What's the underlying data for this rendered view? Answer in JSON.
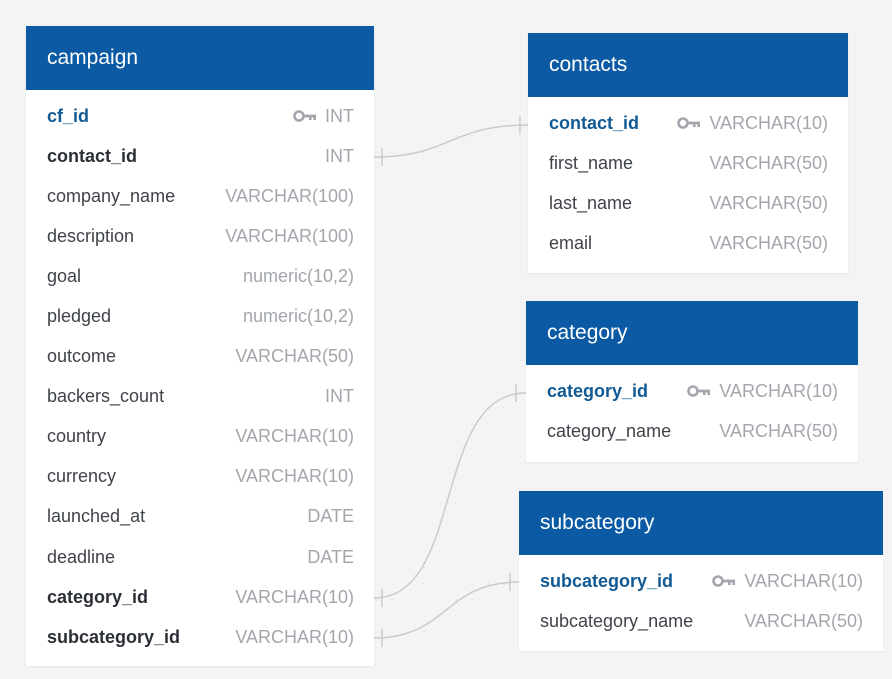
{
  "tables": {
    "campaign": {
      "title": "campaign",
      "columns": [
        {
          "name": "cf_id",
          "type": "INT",
          "role": "pk"
        },
        {
          "name": "contact_id",
          "type": "INT",
          "role": "fk"
        },
        {
          "name": "company_name",
          "type": "VARCHAR(100)",
          "role": ""
        },
        {
          "name": "description",
          "type": "VARCHAR(100)",
          "role": ""
        },
        {
          "name": "goal",
          "type": "numeric(10,2)",
          "role": ""
        },
        {
          "name": "pledged",
          "type": "numeric(10,2)",
          "role": ""
        },
        {
          "name": "outcome",
          "type": "VARCHAR(50)",
          "role": ""
        },
        {
          "name": "backers_count",
          "type": "INT",
          "role": ""
        },
        {
          "name": "country",
          "type": "VARCHAR(10)",
          "role": ""
        },
        {
          "name": "currency",
          "type": "VARCHAR(10)",
          "role": ""
        },
        {
          "name": "launched_at",
          "type": "DATE",
          "role": ""
        },
        {
          "name": "deadline",
          "type": "DATE",
          "role": ""
        },
        {
          "name": "category_id",
          "type": "VARCHAR(10)",
          "role": "fk"
        },
        {
          "name": "subcategory_id",
          "type": "VARCHAR(10)",
          "role": "fk"
        }
      ]
    },
    "contacts": {
      "title": "contacts",
      "columns": [
        {
          "name": "contact_id",
          "type": "VARCHAR(10)",
          "role": "pk"
        },
        {
          "name": "first_name",
          "type": "VARCHAR(50)",
          "role": ""
        },
        {
          "name": "last_name",
          "type": "VARCHAR(50)",
          "role": ""
        },
        {
          "name": "email",
          "type": "VARCHAR(50)",
          "role": ""
        }
      ]
    },
    "category": {
      "title": "category",
      "columns": [
        {
          "name": "category_id",
          "type": "VARCHAR(10)",
          "role": "pk"
        },
        {
          "name": "category_name",
          "type": "VARCHAR(50)",
          "role": ""
        }
      ]
    },
    "subcategory": {
      "title": "subcategory",
      "columns": [
        {
          "name": "subcategory_id",
          "type": "VARCHAR(10)",
          "role": "pk"
        },
        {
          "name": "subcategory_name",
          "type": "VARCHAR(50)",
          "role": ""
        }
      ]
    }
  },
  "icons": {
    "primary_key": "key-icon"
  },
  "colors": {
    "header_bg": "#0b5aa3",
    "pk_text": "#125a93",
    "type_text": "#a3a7ad",
    "connector": "#c9c9cc"
  }
}
